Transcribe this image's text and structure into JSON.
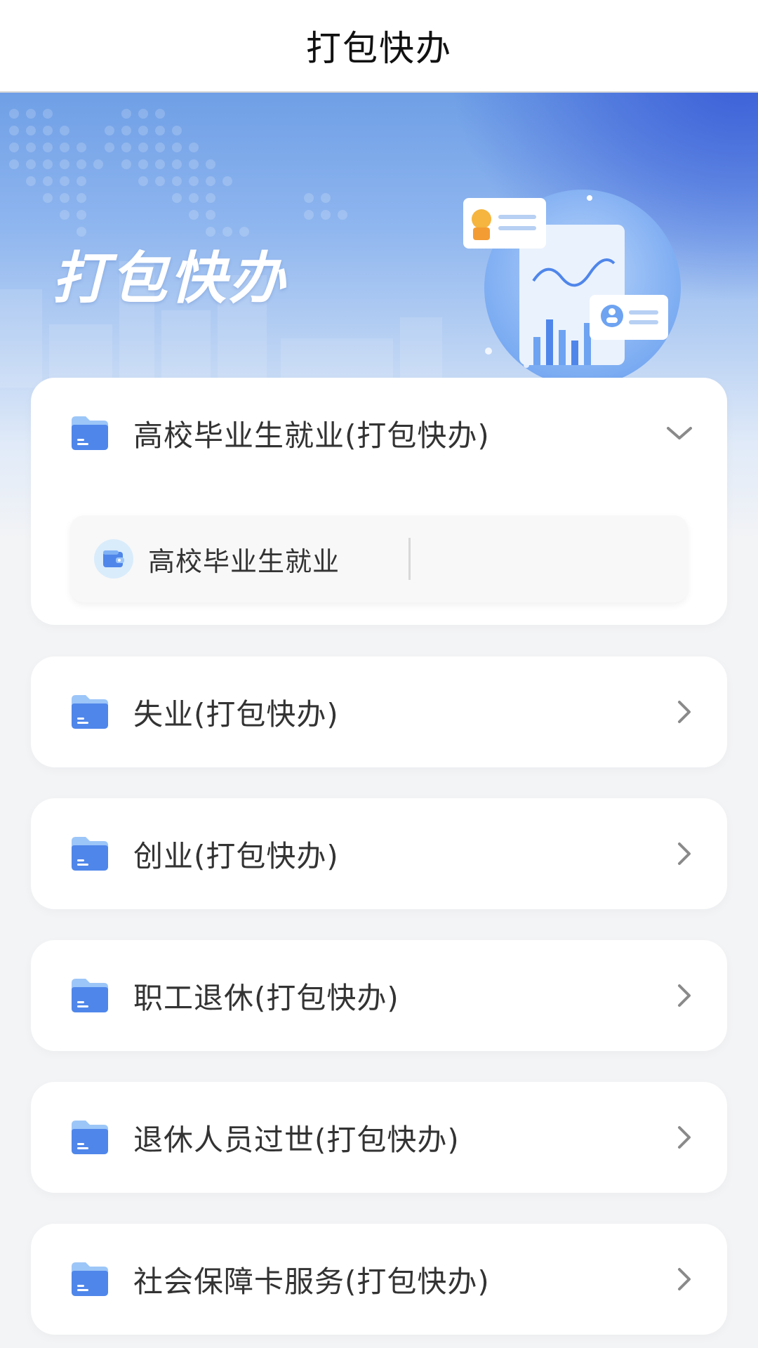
{
  "header": {
    "title": "打包快办"
  },
  "banner": {
    "title": "打包快办"
  },
  "cards": [
    {
      "label": "高校毕业生就业(打包快办)",
      "expanded": true,
      "sub_items": [
        {
          "label": "高校毕业生就业"
        }
      ]
    },
    {
      "label": "失业(打包快办)",
      "expanded": false
    },
    {
      "label": "创业(打包快办)",
      "expanded": false
    },
    {
      "label": "职工退休(打包快办)",
      "expanded": false
    },
    {
      "label": "退休人员过世(打包快办)",
      "expanded": false
    },
    {
      "label": "社会保障卡服务(打包快办)",
      "expanded": false
    }
  ],
  "icons": {
    "folder": "folder-icon",
    "expand": "chevron-down-icon",
    "navigate": "chevron-right-icon",
    "sub_item": "wallet-icon"
  },
  "colors": {
    "accent": "#5b93ec",
    "folder_light": "#9cc6f8",
    "folder_dark": "#4f86ea",
    "text": "#333333",
    "chevron": "#8a8a8a"
  }
}
